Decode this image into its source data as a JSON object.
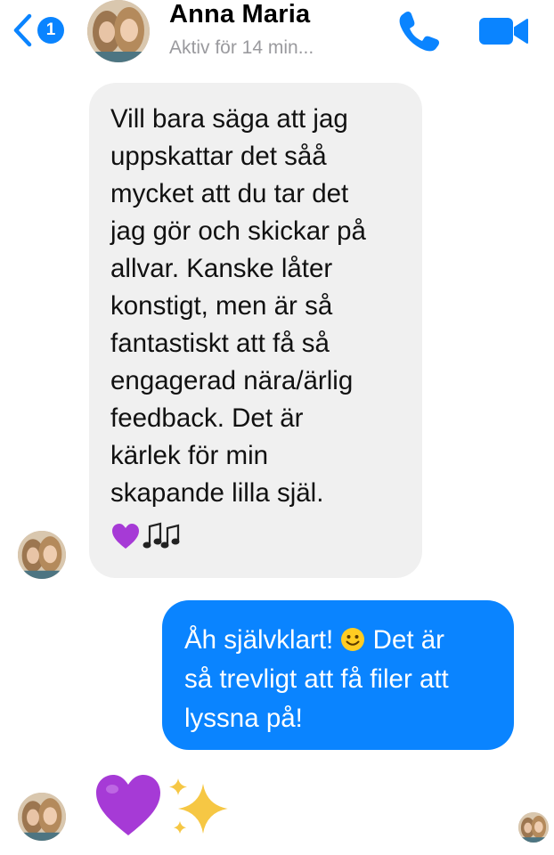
{
  "header": {
    "back_badge": "1",
    "contact_name": "Anna Maria",
    "status": "Aktiv för 14 min..."
  },
  "messages": [
    {
      "direction": "incoming",
      "text": "Vill bara säga att jag\nuppskattar det såå\nmycket att du tar det\njag gör och skickar på\nallvar. Kanske låter\nkonstigt, men är så\nfantastiskt att få så\nengagerad nära/ärlig\nfeedback. Det är\nkärlek för min\nskapande lilla själ.",
      "emoji": [
        "purple-heart",
        "musical-notes"
      ]
    },
    {
      "direction": "outgoing",
      "text_part1": "Åh självklart!",
      "text_part2": " Det är\nså trevligt att få filer att\nlyssna på!",
      "emoji": [
        "smiling-face"
      ]
    },
    {
      "direction": "incoming",
      "emoji": [
        "purple-heart",
        "sparkles"
      ]
    }
  ],
  "colors": {
    "accent": "#0a84ff",
    "incoming_bubble": "#f0f0f0",
    "status_text": "#9a9a9e",
    "purple_heart": "#a63ad6"
  },
  "icons": [
    "chevron-left-icon",
    "phone-icon",
    "video-camera-icon"
  ]
}
